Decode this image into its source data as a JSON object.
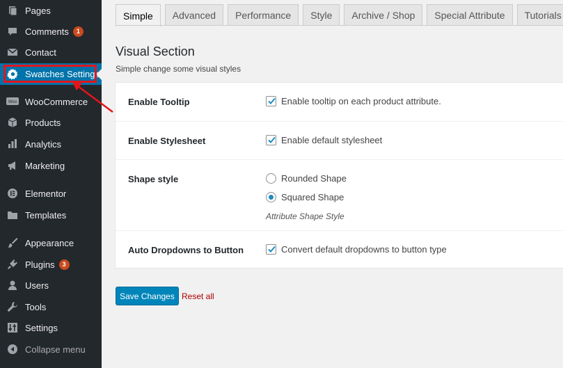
{
  "sidebar": {
    "items": [
      {
        "label": "Pages",
        "icon": "pages-icon"
      },
      {
        "label": "Comments",
        "icon": "comments-icon",
        "badge": "1"
      },
      {
        "label": "Contact",
        "icon": "mail-icon"
      },
      {
        "label": "Swatches Settings",
        "icon": "gear-icon",
        "active": true
      },
      {
        "label": "WooCommerce",
        "icon": "woo-icon"
      },
      {
        "label": "Products",
        "icon": "box-icon"
      },
      {
        "label": "Analytics",
        "icon": "bar-chart-icon"
      },
      {
        "label": "Marketing",
        "icon": "megaphone-icon"
      },
      {
        "label": "Elementor",
        "icon": "elementor-icon"
      },
      {
        "label": "Templates",
        "icon": "folder-icon"
      },
      {
        "label": "Appearance",
        "icon": "brush-icon"
      },
      {
        "label": "Plugins",
        "icon": "plug-icon",
        "badge": "3"
      },
      {
        "label": "Users",
        "icon": "user-icon"
      },
      {
        "label": "Tools",
        "icon": "wrench-icon"
      },
      {
        "label": "Settings",
        "icon": "settings-sliders-icon"
      }
    ],
    "collapse_label": "Collapse menu"
  },
  "tabs": [
    {
      "label": "Simple",
      "active": true
    },
    {
      "label": "Advanced"
    },
    {
      "label": "Performance"
    },
    {
      "label": "Style"
    },
    {
      "label": "Archive / Shop"
    },
    {
      "label": "Special Attribute"
    },
    {
      "label": "Tutorials"
    }
  ],
  "section": {
    "title": "Visual Section",
    "description": "Simple change some visual styles"
  },
  "settings": {
    "tooltip": {
      "label": "Enable Tooltip",
      "option": "Enable tooltip on each product attribute.",
      "checked": true
    },
    "stylesheet": {
      "label": "Enable Stylesheet",
      "option": "Enable default stylesheet",
      "checked": true
    },
    "shape": {
      "label": "Shape style",
      "options": [
        "Rounded Shape",
        "Squared Shape"
      ],
      "selected": "Squared Shape",
      "hint": "Attribute Shape Style"
    },
    "dropdowns": {
      "label": "Auto Dropdowns to Button",
      "option": "Convert default dropdowns to button type",
      "checked": true
    }
  },
  "actions": {
    "save_label": "Save Changes",
    "reset_label": "Reset all"
  },
  "colors": {
    "sidebar_bg": "#23282d",
    "active_item": "#0073aa",
    "highlight": "#e3151a",
    "badge": "#ca4a1f",
    "primary_button": "#0085ba",
    "reset_link": "#aa0000"
  }
}
